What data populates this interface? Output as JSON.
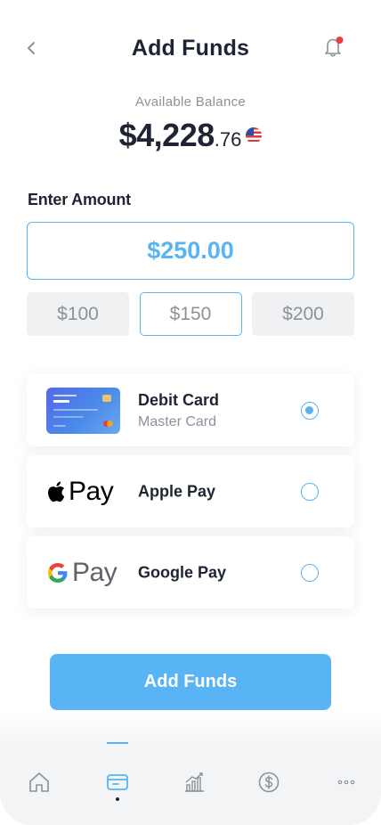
{
  "header": {
    "title": "Add Funds"
  },
  "balance": {
    "label": "Available Balance",
    "main": "$4,228",
    "cents": ".76",
    "flag_icon": "us-flag-icon"
  },
  "amount": {
    "label": "Enter Amount",
    "value": "$250.00"
  },
  "presets": [
    {
      "label": "$100",
      "selected": false
    },
    {
      "label": "$150",
      "selected": true
    },
    {
      "label": "$200",
      "selected": false
    }
  ],
  "methods": [
    {
      "name": "Debit Card",
      "sub": "Master Card",
      "icon": "credit-card-icon",
      "selected": true
    },
    {
      "name": "Apple Pay",
      "sub": "",
      "logo_text": "Pay",
      "icon": "apple-pay-logo",
      "selected": false
    },
    {
      "name": "Google Pay",
      "sub": "",
      "logo_text": "Pay",
      "icon": "google-pay-logo",
      "selected": false
    }
  ],
  "card": {
    "balance": "$4,228.76"
  },
  "submit_label": "Add Funds",
  "tabs": [
    {
      "icon": "home-icon"
    },
    {
      "icon": "card-icon",
      "active": true
    },
    {
      "icon": "chart-icon"
    },
    {
      "icon": "dollar-icon"
    },
    {
      "icon": "more-icon"
    }
  ],
  "colors": {
    "accent": "#58b4f4",
    "text": "#1e2433",
    "muted": "#8c919b",
    "chip_bg": "#f0f1f3"
  }
}
